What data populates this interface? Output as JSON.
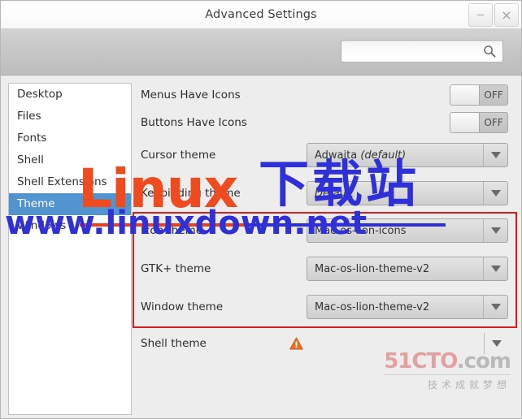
{
  "window": {
    "title": "Advanced Settings",
    "minimize_label": "−",
    "close_label": "×"
  },
  "search": {
    "value": "",
    "placeholder": "",
    "icon": "search-icon"
  },
  "sidebar": {
    "items": [
      {
        "label": "Desktop",
        "selected": false
      },
      {
        "label": "Files",
        "selected": false
      },
      {
        "label": "Fonts",
        "selected": false
      },
      {
        "label": "Shell",
        "selected": false
      },
      {
        "label": "Shell Extensions",
        "selected": false
      },
      {
        "label": "Theme",
        "selected": true
      },
      {
        "label": "Windows",
        "selected": false
      }
    ],
    "selected_color": "#5294d0"
  },
  "settings": {
    "rows": [
      {
        "label": "Menus Have Icons",
        "type": "switch",
        "state": "OFF"
      },
      {
        "label": "Buttons Have Icons",
        "type": "switch",
        "state": "OFF"
      },
      {
        "label": "Cursor theme",
        "type": "combo",
        "value": "Adwaita",
        "value_italic": "(default)"
      },
      {
        "label": "Keybinding theme",
        "type": "combo",
        "value": "",
        "value_italic": "Default"
      },
      {
        "label": "Icon theme",
        "type": "combo",
        "value": "Mac-os-lion-icons",
        "value_italic": ""
      },
      {
        "label": "GTK+ theme",
        "type": "combo",
        "value": "Mac-os-lion-theme-v2",
        "value_italic": ""
      },
      {
        "label": "Window theme",
        "type": "combo",
        "value": "Mac-os-lion-theme-v2",
        "value_italic": ""
      },
      {
        "label": "Shell theme",
        "type": "plain",
        "value": "",
        "warning": "warning-triangle-icon"
      }
    ]
  },
  "annotations": {
    "highlight_box_color": "#d42020",
    "underline_red_color": "#e8401a",
    "underline_blue_color": "#2f30d8"
  },
  "watermarks": {
    "linux_text": "Linux",
    "chinese_text": "下载站",
    "url_text": "www.linuxdown.net",
    "cto_number": "51CTO",
    "cto_domain": ".com",
    "cto_slogan": "技术成就梦想"
  }
}
